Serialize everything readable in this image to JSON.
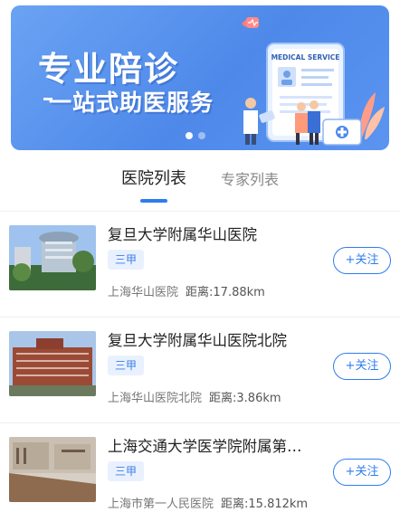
{
  "banner": {
    "title": "专业陪诊",
    "subtitle": "一站式助医服务",
    "card_label": "MEDICAL SERVICE"
  },
  "tabs": [
    {
      "label": "医院列表",
      "active": true
    },
    {
      "label": "专家列表",
      "active": false
    }
  ],
  "hospitals": [
    {
      "name": "复旦大学附属华山医院",
      "level": "三甲",
      "location": "上海华山医院",
      "distance": "距离:17.88km",
      "follow_label": "+关注"
    },
    {
      "name": "复旦大学附属华山医院北院",
      "level": "三甲",
      "location": "上海华山医院北院",
      "distance": "距离:3.86km",
      "follow_label": "+关注"
    },
    {
      "name": "上海交通大学医学院附属第…",
      "level": "三甲",
      "location": "上海市第一人民医院",
      "distance": "距离:15.812km",
      "follow_label": "+关注"
    }
  ],
  "colors": {
    "accent": "#2f7cf0",
    "banner": "#5b94f0",
    "badge_bg": "#e9f1ff"
  }
}
